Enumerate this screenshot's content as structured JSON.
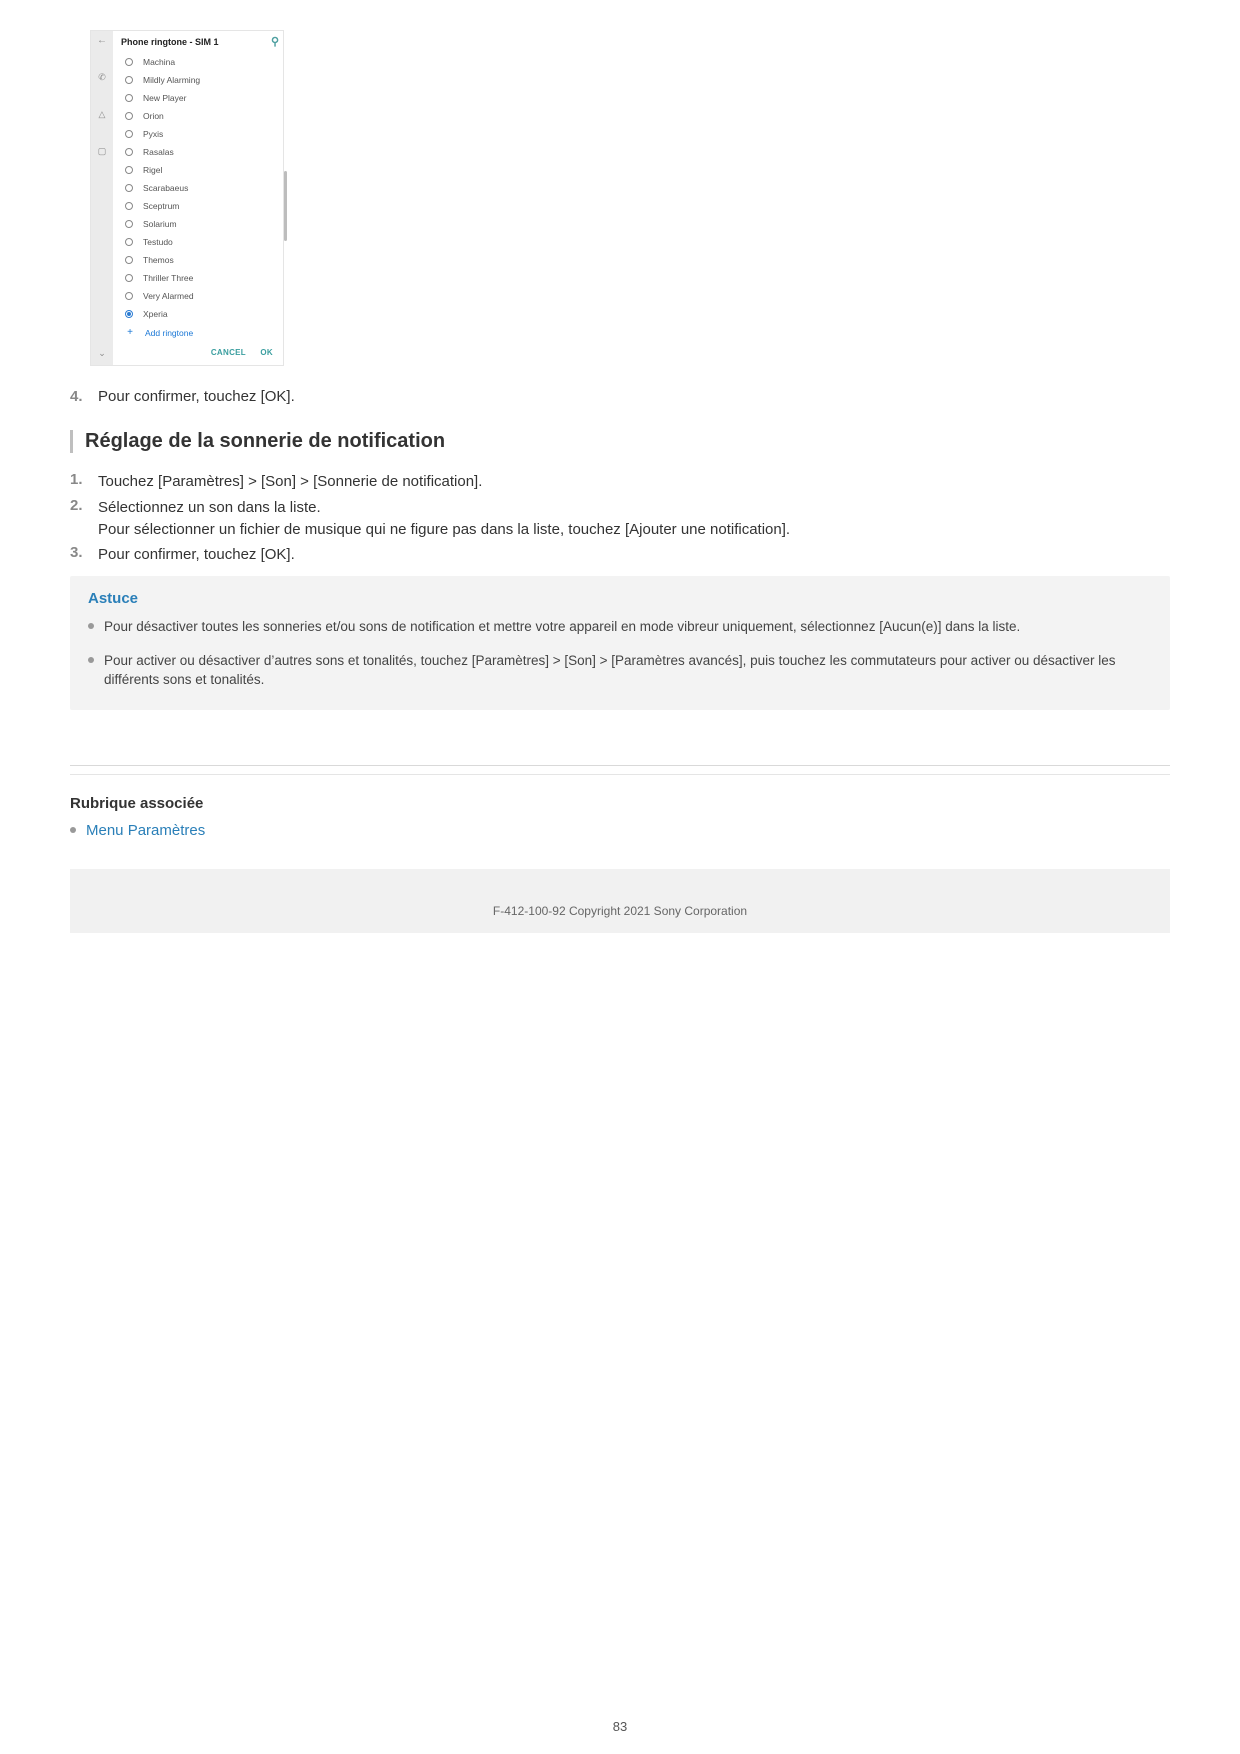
{
  "phone": {
    "dialog_title": "Phone ringtone - SIM 1",
    "selected_index": 14,
    "items": [
      "Machina",
      "Mildly Alarming",
      "New Player",
      "Orion",
      "Pyxis",
      "Rasalas",
      "Rigel",
      "Scarabaeus",
      "Sceptrum",
      "Solarium",
      "Testudo",
      "Themos",
      "Thriller Three",
      "Very Alarmed",
      "Xperia"
    ],
    "add_label": "Add ringtone",
    "cancel": "CANCEL",
    "ok": "OK"
  },
  "step4": {
    "num": "4.",
    "text": "Pour confirmer, touchez [OK]."
  },
  "section_heading": "Réglage de la sonnerie de notification",
  "steps": [
    {
      "num": "1.",
      "lines": [
        "Touchez [Paramètres] > [Son] > [Sonnerie de notification]."
      ]
    },
    {
      "num": "2.",
      "lines": [
        "Sélectionnez un son dans la liste.",
        "Pour sélectionner un fichier de musique qui ne figure pas dans la liste, touchez [Ajouter une notification]."
      ]
    },
    {
      "num": "3.",
      "lines": [
        "Pour confirmer, touchez [OK]."
      ]
    }
  ],
  "tip": {
    "title": "Astuce",
    "bullets": [
      "Pour désactiver toutes les sonneries et/ou sons de notification et mettre votre appareil en mode vibreur uniquement, sélectionnez [Aucun(e)] dans la liste.",
      "Pour activer ou désactiver d’autres sons et tonalités, touchez [Paramètres] > [Son] > [Paramètres avancés], puis touchez les commutateurs pour activer ou désactiver les différents sons et tonalités."
    ]
  },
  "related": {
    "title": "Rubrique associée",
    "items": [
      "Menu Paramètres"
    ]
  },
  "footer": "F-412-100-92 Copyright 2021 Sony Corporation",
  "page_number": "83"
}
